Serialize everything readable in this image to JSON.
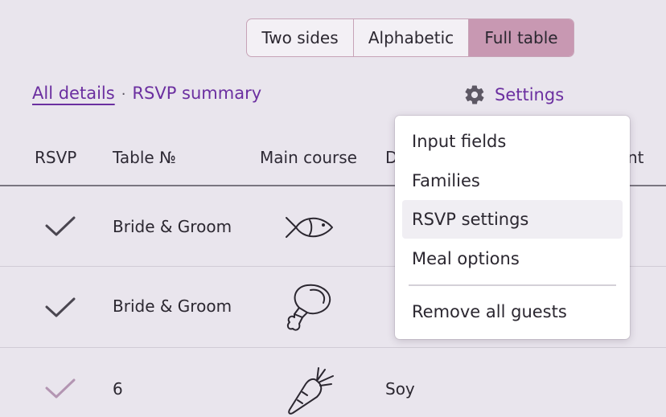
{
  "view_switch": {
    "options": [
      "Two sides",
      "Alphabetic",
      "Full table"
    ],
    "selected": "Full table"
  },
  "links": {
    "all_details": "All details",
    "separator": "·",
    "rsvp_summary": "RSVP summary",
    "settings": "Settings"
  },
  "table": {
    "headers": {
      "rsvp": "RSVP",
      "table_no": "Table №",
      "main_course": "Main course",
      "dietary": "D",
      "extra": "nt"
    },
    "rows": [
      {
        "rsvp": "confirmed",
        "rsvp_icon": "check-icon",
        "table": "Bride & Groom",
        "meal_icon": "fish-icon",
        "dietary": ""
      },
      {
        "rsvp": "confirmed",
        "rsvp_icon": "check-icon",
        "table": "Bride & Groom",
        "meal_icon": "meat-icon",
        "dietary": ""
      },
      {
        "rsvp": "confirmed-light",
        "rsvp_icon": "check-icon",
        "table": "6",
        "meal_icon": "carrot-icon",
        "dietary": "Soy"
      }
    ]
  },
  "settings_menu": {
    "items": [
      "Input fields",
      "Families",
      "RSVP settings",
      "Meal options"
    ],
    "hovered": "RSVP settings",
    "danger_item": "Remove all guests"
  },
  "colors": {
    "accent": "#6b2fa0",
    "segment_active": "#c898b2",
    "check_dark": "#4a4650",
    "check_light": "#b395b2"
  }
}
